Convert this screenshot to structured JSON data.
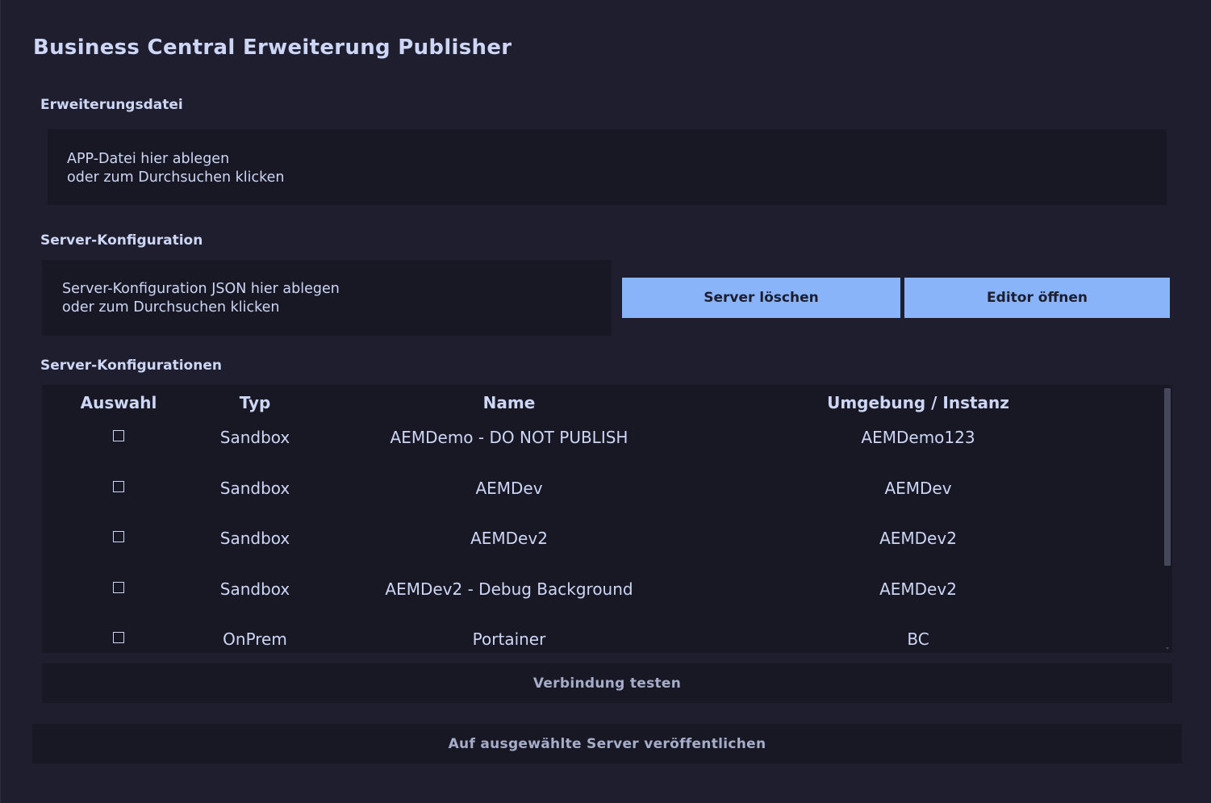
{
  "app": {
    "title": "Business Central Erweiterung Publisher"
  },
  "extension_file": {
    "label": "Erweiterungsdatei",
    "drop_line1": "APP-Datei hier ablegen",
    "drop_line2": "oder zum Durchsuchen klicken"
  },
  "server_config": {
    "label": "Server-Konfiguration",
    "drop_line1": "Server-Konfiguration JSON hier ablegen",
    "drop_line2": "oder zum Durchsuchen klicken",
    "delete_button": "Server löschen",
    "editor_button": "Editor öffnen"
  },
  "server_configs": {
    "label": "Server-Konfigurationen",
    "columns": [
      "Auswahl",
      "Typ",
      "Name",
      "Umgebung / Instanz"
    ],
    "rows": [
      {
        "selected": false,
        "type": "Sandbox",
        "name": "AEMDemo - DO NOT PUBLISH",
        "environment": "AEMDemo123"
      },
      {
        "selected": false,
        "type": "Sandbox",
        "name": "AEMDev",
        "environment": "AEMDev"
      },
      {
        "selected": false,
        "type": "Sandbox",
        "name": "AEMDev2",
        "environment": "AEMDev2"
      },
      {
        "selected": false,
        "type": "Sandbox",
        "name": "AEMDev2 - Debug Background",
        "environment": "AEMDev2"
      },
      {
        "selected": false,
        "type": "OnPrem",
        "name": "Portainer",
        "environment": "BC"
      }
    ]
  },
  "actions": {
    "test_connection": "Verbindung testen",
    "publish": "Auf ausgewählte Server veröffentlichen"
  },
  "colors": {
    "background": "#1e1e2e",
    "panel": "#181825",
    "accent": "#89b4fa",
    "text": "#cdd6f4"
  }
}
